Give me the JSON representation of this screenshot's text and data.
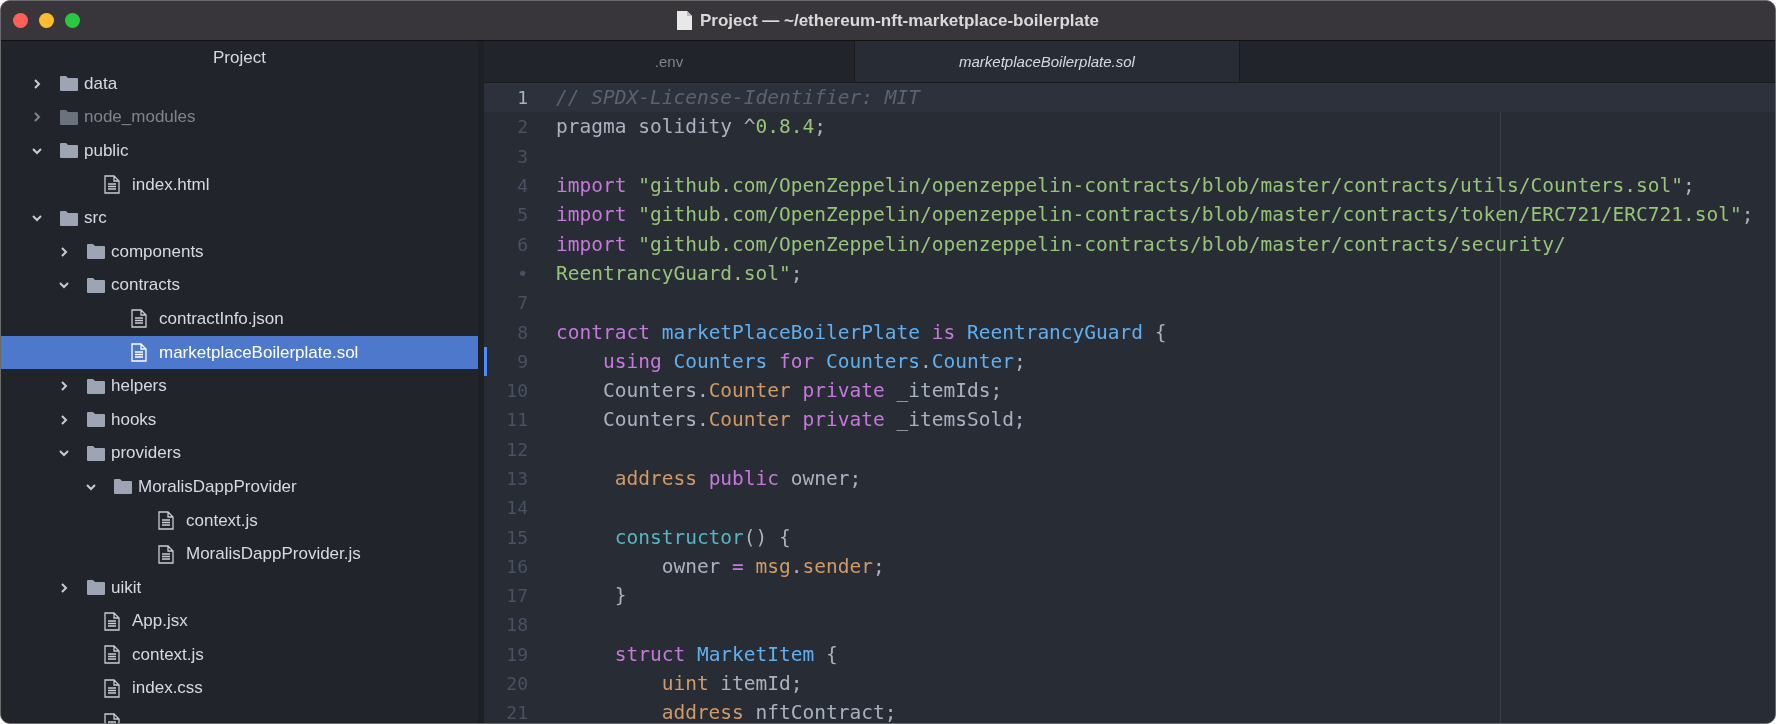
{
  "window": {
    "title": "Project — ~/ethereum-nft-marketplace-boilerplate"
  },
  "sidebar": {
    "title": "Project",
    "tree": [
      {
        "name": "data",
        "kind": "folder",
        "expanded": false,
        "dimmed": false,
        "selected": false
      },
      {
        "name": "node_modules",
        "kind": "folder",
        "expanded": false,
        "dimmed": true,
        "selected": false
      },
      {
        "name": "public",
        "kind": "folder",
        "expanded": true,
        "dimmed": false,
        "selected": false,
        "children": [
          {
            "name": "index.html",
            "kind": "file",
            "dimmed": false,
            "selected": false
          }
        ]
      },
      {
        "name": "src",
        "kind": "folder",
        "expanded": true,
        "dimmed": false,
        "selected": false,
        "children": [
          {
            "name": "components",
            "kind": "folder",
            "expanded": false,
            "dimmed": false,
            "selected": false
          },
          {
            "name": "contracts",
            "kind": "folder",
            "expanded": true,
            "dimmed": false,
            "selected": false,
            "children": [
              {
                "name": "contractInfo.json",
                "kind": "file",
                "dimmed": false,
                "selected": false
              },
              {
                "name": "marketplaceBoilerplate.sol",
                "kind": "file",
                "dimmed": false,
                "selected": true
              }
            ]
          },
          {
            "name": "helpers",
            "kind": "folder",
            "expanded": false,
            "dimmed": false,
            "selected": false
          },
          {
            "name": "hooks",
            "kind": "folder",
            "expanded": false,
            "dimmed": false,
            "selected": false
          },
          {
            "name": "providers",
            "kind": "folder",
            "expanded": true,
            "dimmed": false,
            "selected": false,
            "children": [
              {
                "name": "MoralisDappProvider",
                "kind": "folder",
                "expanded": true,
                "dimmed": false,
                "selected": false,
                "children": [
                  {
                    "name": "context.js",
                    "kind": "file",
                    "dimmed": false,
                    "selected": false
                  },
                  {
                    "name": "MoralisDappProvider.js",
                    "kind": "file",
                    "dimmed": false,
                    "selected": false
                  }
                ]
              }
            ]
          },
          {
            "name": "uikit",
            "kind": "folder",
            "expanded": false,
            "dimmed": false,
            "selected": false
          },
          {
            "name": "App.jsx",
            "kind": "file",
            "dimmed": false,
            "selected": false
          },
          {
            "name": "context.js",
            "kind": "file",
            "dimmed": false,
            "selected": false
          },
          {
            "name": "index.css",
            "kind": "file",
            "dimmed": false,
            "selected": false
          },
          {
            "kind": "file",
            "dimmed": false,
            "selected": false
          }
        ]
      }
    ]
  },
  "tabs": [
    {
      "label": ".env",
      "selected": false,
      "preview": false
    },
    {
      "label": "marketplaceBoilerplate.sol",
      "selected": true,
      "preview": true
    }
  ],
  "editor": {
    "lines": [
      {
        "number": "1",
        "current": true,
        "modified": false,
        "tokens": [
          {
            "kind": "comment",
            "text": "// SPDX-License-Identifier: MIT"
          }
        ]
      },
      {
        "number": "2",
        "current": false,
        "modified": false,
        "tokens": [
          {
            "kind": "plain",
            "text": "pragma solidity ^"
          },
          {
            "kind": "number",
            "text": "0.8.4"
          },
          {
            "kind": "plain",
            "text": ";"
          }
        ]
      },
      {
        "number": "3",
        "current": false,
        "modified": false
      },
      {
        "number": "4",
        "current": false,
        "modified": false,
        "tokens": [
          {
            "kind": "keyword",
            "text": "import "
          },
          {
            "kind": "string",
            "text": "\"github.com/OpenZeppelin/openzeppelin-contracts/blob/master/contracts/utils/Counters.sol\""
          },
          {
            "kind": "plain",
            "text": ";"
          }
        ]
      },
      {
        "number": "5",
        "current": false,
        "modified": false,
        "tokens": [
          {
            "kind": "keyword",
            "text": "import "
          },
          {
            "kind": "string",
            "text": "\"github.com/OpenZeppelin/openzeppelin-contracts/blob/master/contracts/token/ERC721/ERC721.sol\""
          },
          {
            "kind": "plain",
            "text": ";"
          }
        ]
      },
      {
        "number": "6",
        "current": false,
        "modified": false,
        "tokens": [
          {
            "kind": "keyword",
            "text": "import "
          },
          {
            "kind": "string",
            "text": "\"github.com/OpenZeppelin/openzeppelin-contracts/blob/master/contracts/security/"
          }
        ]
      },
      {
        "number": "•",
        "current": false,
        "modified": false,
        "tokens": [
          {
            "kind": "string",
            "text": "ReentrancyGuard.sol\""
          },
          {
            "kind": "plain",
            "text": ";"
          }
        ]
      },
      {
        "number": "7",
        "current": false,
        "modified": false
      },
      {
        "number": "8",
        "current": false,
        "modified": false,
        "tokens": [
          {
            "kind": "keyword",
            "text": "contract "
          },
          {
            "kind": "type",
            "text": "marketPlaceBoilerPlate "
          },
          {
            "kind": "keyword",
            "text": "is "
          },
          {
            "kind": "type",
            "text": "ReentrancyGuard"
          },
          {
            "kind": "plain",
            "text": " {"
          }
        ]
      },
      {
        "number": "9",
        "current": false,
        "modified": true,
        "tokens": [
          {
            "kind": "keyword",
            "text": "    using "
          },
          {
            "kind": "type",
            "text": "Counters "
          },
          {
            "kind": "keyword",
            "text": "for "
          },
          {
            "kind": "type",
            "text": "Counters"
          },
          {
            "kind": "plain",
            "text": "."
          },
          {
            "kind": "type",
            "text": "Counter"
          },
          {
            "kind": "plain",
            "text": ";"
          }
        ]
      },
      {
        "number": "10",
        "current": false,
        "modified": false,
        "tokens": [
          {
            "kind": "plain",
            "text": "    Counters."
          },
          {
            "kind": "storage",
            "text": "Counter "
          },
          {
            "kind": "keyword",
            "text": "private"
          },
          {
            "kind": "plain",
            "text": " _itemIds;"
          }
        ]
      },
      {
        "number": "11",
        "current": false,
        "modified": false,
        "tokens": [
          {
            "kind": "plain",
            "text": "    Counters."
          },
          {
            "kind": "storage",
            "text": "Counter "
          },
          {
            "kind": "keyword",
            "text": "private"
          },
          {
            "kind": "plain",
            "text": " _itemsSold;"
          }
        ]
      },
      {
        "number": "12",
        "current": false,
        "modified": false
      },
      {
        "number": "13",
        "current": false,
        "modified": false,
        "tokens": [
          {
            "kind": "storage",
            "text": "     address "
          },
          {
            "kind": "keyword",
            "text": "public"
          },
          {
            "kind": "plain",
            "text": " owner;"
          }
        ]
      },
      {
        "number": "14",
        "current": false,
        "modified": false
      },
      {
        "number": "15",
        "current": false,
        "modified": false,
        "tokens": [
          {
            "kind": "func",
            "text": "     constructor"
          },
          {
            "kind": "plain",
            "text": "() {"
          }
        ]
      },
      {
        "number": "16",
        "current": false,
        "modified": false,
        "tokens": [
          {
            "kind": "plain",
            "text": "         owner "
          },
          {
            "kind": "keyword",
            "text": "= "
          },
          {
            "kind": "storage",
            "text": "msg"
          },
          {
            "kind": "plain",
            "text": "."
          },
          {
            "kind": "storage",
            "text": "sender"
          },
          {
            "kind": "plain",
            "text": ";"
          }
        ]
      },
      {
        "number": "17",
        "current": false,
        "modified": false,
        "tokens": [
          {
            "kind": "plain",
            "text": "     }"
          }
        ]
      },
      {
        "number": "18",
        "current": false,
        "modified": false
      },
      {
        "number": "19",
        "current": false,
        "modified": false,
        "tokens": [
          {
            "kind": "keyword",
            "text": "     struct "
          },
          {
            "kind": "type",
            "text": "MarketItem"
          },
          {
            "kind": "plain",
            "text": " {"
          }
        ]
      },
      {
        "number": "20",
        "current": false,
        "modified": false,
        "tokens": [
          {
            "kind": "storage",
            "text": "         uint"
          },
          {
            "kind": "plain",
            "text": " itemId;"
          }
        ]
      },
      {
        "number": "21",
        "current": false,
        "modified": false,
        "tokens": [
          {
            "kind": "storage",
            "text": "         address"
          },
          {
            "kind": "plain",
            "text": " nftContract;"
          }
        ]
      }
    ]
  }
}
